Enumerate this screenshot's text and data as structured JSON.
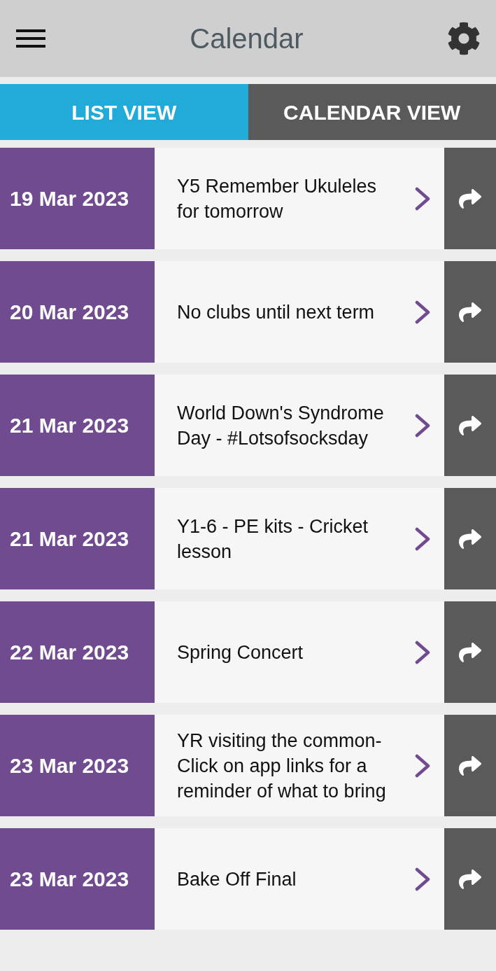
{
  "header": {
    "title": "Calendar"
  },
  "tabs": [
    {
      "label": "LIST VIEW",
      "selected": true
    },
    {
      "label": "CALENDAR VIEW",
      "selected": false
    }
  ],
  "events": [
    {
      "date": "19 Mar 2023",
      "title": "Y5 Remember Ukuleles for tomorrow"
    },
    {
      "date": "20 Mar 2023",
      "title": "No clubs until next term"
    },
    {
      "date": "21 Mar 2023",
      "title": "World Down's Syndrome Day - #Lotsofsocksday"
    },
    {
      "date": "21 Mar 2023",
      "title": "Y1-6 - PE kits - Cricket lesson"
    },
    {
      "date": "22 Mar 2023",
      "title": "Spring Concert"
    },
    {
      "date": "23 Mar 2023",
      "title": "YR visiting the common-Click on app links for a reminder of what to bring"
    },
    {
      "date": "23 Mar 2023",
      "title": "Bake Off Final"
    }
  ]
}
